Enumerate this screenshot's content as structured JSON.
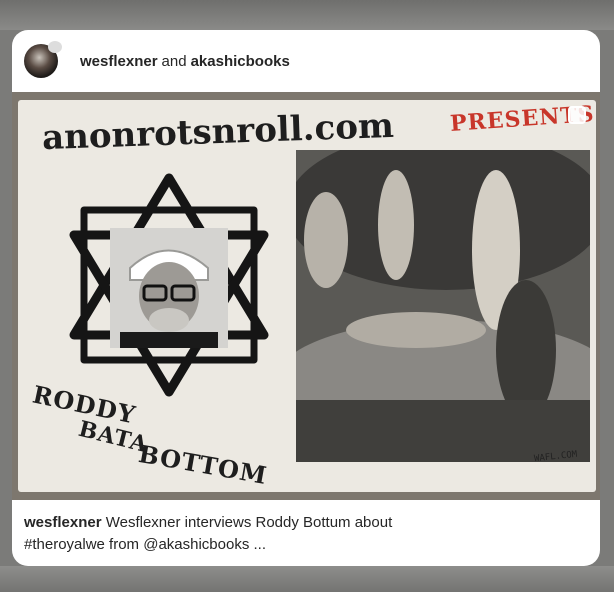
{
  "post": {
    "author_primary": "wesflexner",
    "connector": "and",
    "author_secondary": "akashicbooks"
  },
  "photo": {
    "logo_text": "anonrotsnroll.com",
    "presents_text": "PRESENTS",
    "name_line_1": "RODDY",
    "name_line_2": "BATA",
    "name_line_3": "BOTTOM",
    "stamp_text": "WAFL.COM"
  },
  "caption": {
    "author": "wesflexner",
    "text_line_1": "Wesflexner interviews Roddy Bottum about",
    "text_line_2": "#theroyalwe from @akashicbooks ..."
  },
  "colors": {
    "card": "#ffffff",
    "text": "#262626",
    "presents_red": "#c8362a"
  }
}
